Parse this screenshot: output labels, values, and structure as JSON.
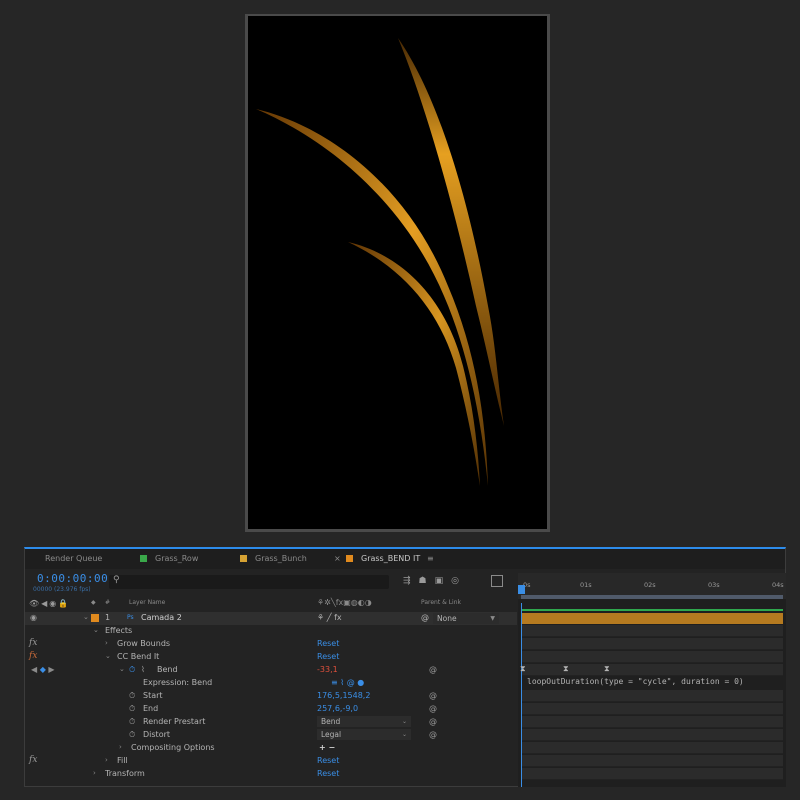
{
  "tabs": [
    {
      "label": "Render Queue",
      "color": ""
    },
    {
      "label": "Grass_Row",
      "color": "#3aa84a"
    },
    {
      "label": "Grass_Bunch",
      "color": "#d6a233"
    },
    {
      "label": "Grass_BEND IT",
      "color": "#e08a1e"
    }
  ],
  "tab_close": "×",
  "tab_menu": "≡",
  "timecode": "0:00:00:00",
  "fps": "00000 (23.976 fps)",
  "search_icon": "search-icon",
  "columns": {
    "number": "#",
    "layer_name": "Layer Name",
    "parent": "Parent & Link"
  },
  "layer": {
    "index": "1",
    "type_badge": "Ps",
    "name": "Camada 2",
    "parent_value": "None"
  },
  "properties": {
    "effects": "Effects",
    "grow_bounds": "Grow Bounds",
    "cc_bend_it": "CC Bend It",
    "bend": "Bend",
    "bend_value": "-33,1",
    "expression_label": "Expression: Bend",
    "start": "Start",
    "start_value": "176,5,1548,2",
    "end": "End",
    "end_value": "257,6,-9,0",
    "render_prestart": "Render Prestart",
    "render_prestart_value": "Bend",
    "distort": "Distort",
    "distort_value": "Legal",
    "compositing": "Compositing Options",
    "fill": "Fill",
    "transform": "Transform",
    "reset": "Reset",
    "compositing_buttons": "+ −"
  },
  "ruler": [
    "0s",
    "01s",
    "02s",
    "03s",
    "04s"
  ],
  "expression_text": "loopOutDuration(type = \"cycle\", duration = 0)",
  "colors": {
    "accent": "#3a8ee6",
    "grass": "#f0a020",
    "layer_bar": "#b57a20",
    "red_value": "#e0503c"
  }
}
